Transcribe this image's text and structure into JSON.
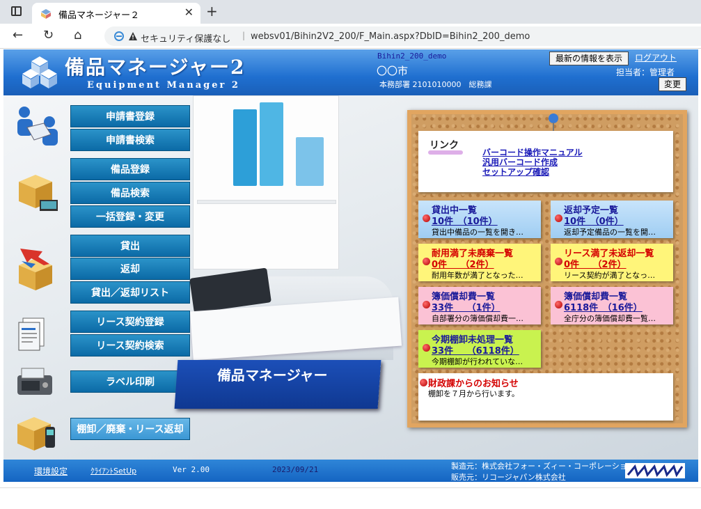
{
  "browser": {
    "tab_title": "備品マネージャー２",
    "security_warning": "セキュリティ保護なし",
    "url": "websv01/Bihin2V2_200/F_Main.aspx?DbID=Bihin2_200_demo"
  },
  "header": {
    "title": "備品マネージャー2",
    "subtitle": "Equipment Manager 2",
    "db_id": "Bihin2_200_demo",
    "city": "〇〇市",
    "department": "本務部署 2101010000　総務課",
    "latest_button": "最新の情報を表示",
    "logout": "ログアウト",
    "person_in_charge": "担当者：管理者",
    "change_button": "変更"
  },
  "menu": {
    "application_register": "申請書登録",
    "application_search": "申請書検索",
    "equipment_register": "備品登録",
    "equipment_search": "備品検索",
    "bulk_register": "一括登録・変更",
    "lend": "貸出",
    "return": "返却",
    "lend_return_list": "貸出／返却リスト",
    "lease_register": "リース契約登録",
    "lease_search": "リース契約検索",
    "label_print": "ラベル印刷",
    "inventory": "棚卸／廃棄・リース返却"
  },
  "banner": "備品マネージャー",
  "board": {
    "link_label": "リンク",
    "links": [
      "バーコード操作マニュアル",
      "汎用バーコード作成",
      "セットアップ確認"
    ],
    "notes": [
      {
        "title": "貸出中一覧",
        "count": "10件　（10件）",
        "desc": "貸出中備品の一覧を開き…"
      },
      {
        "title": "返却予定一覧",
        "count": "10件　（0件）",
        "desc": "返却予定備品の一覧を開…"
      },
      {
        "title": "耐用満了未廃棄一覧",
        "count": "0件　　（2件）",
        "desc": "耐用年数が満了となった…"
      },
      {
        "title": "リース満了未返却一覧",
        "count": "0件　　（2件）",
        "desc": "リース契約が満了となっ…"
      },
      {
        "title": "簿価償却費一覧",
        "count": "33件　　（1件）",
        "desc": "自部署分の簿価償却費一…"
      },
      {
        "title": "簿価償却費一覧",
        "count": "6118件　（16件）",
        "desc": "全庁分の簿価償却費一覧…"
      },
      {
        "title": "今期棚卸未処理一覧",
        "count": "33件　　（6118件）",
        "desc": "今期棚卸が行われていな…"
      }
    ],
    "finance_title": "財政課からのお知らせ",
    "finance_text": "棚卸を７月から行います。"
  },
  "footer": {
    "settings": "環境設定",
    "client_setup": "ｸﾗｲｱﾝﾄSetUp",
    "version": "Ver 2.00",
    "date": "2023/09/21",
    "manufacturer": "製造元：株式会社フォー・ズィー・コーポレーション",
    "seller": "販売元：リコージャパン株式会社"
  }
}
